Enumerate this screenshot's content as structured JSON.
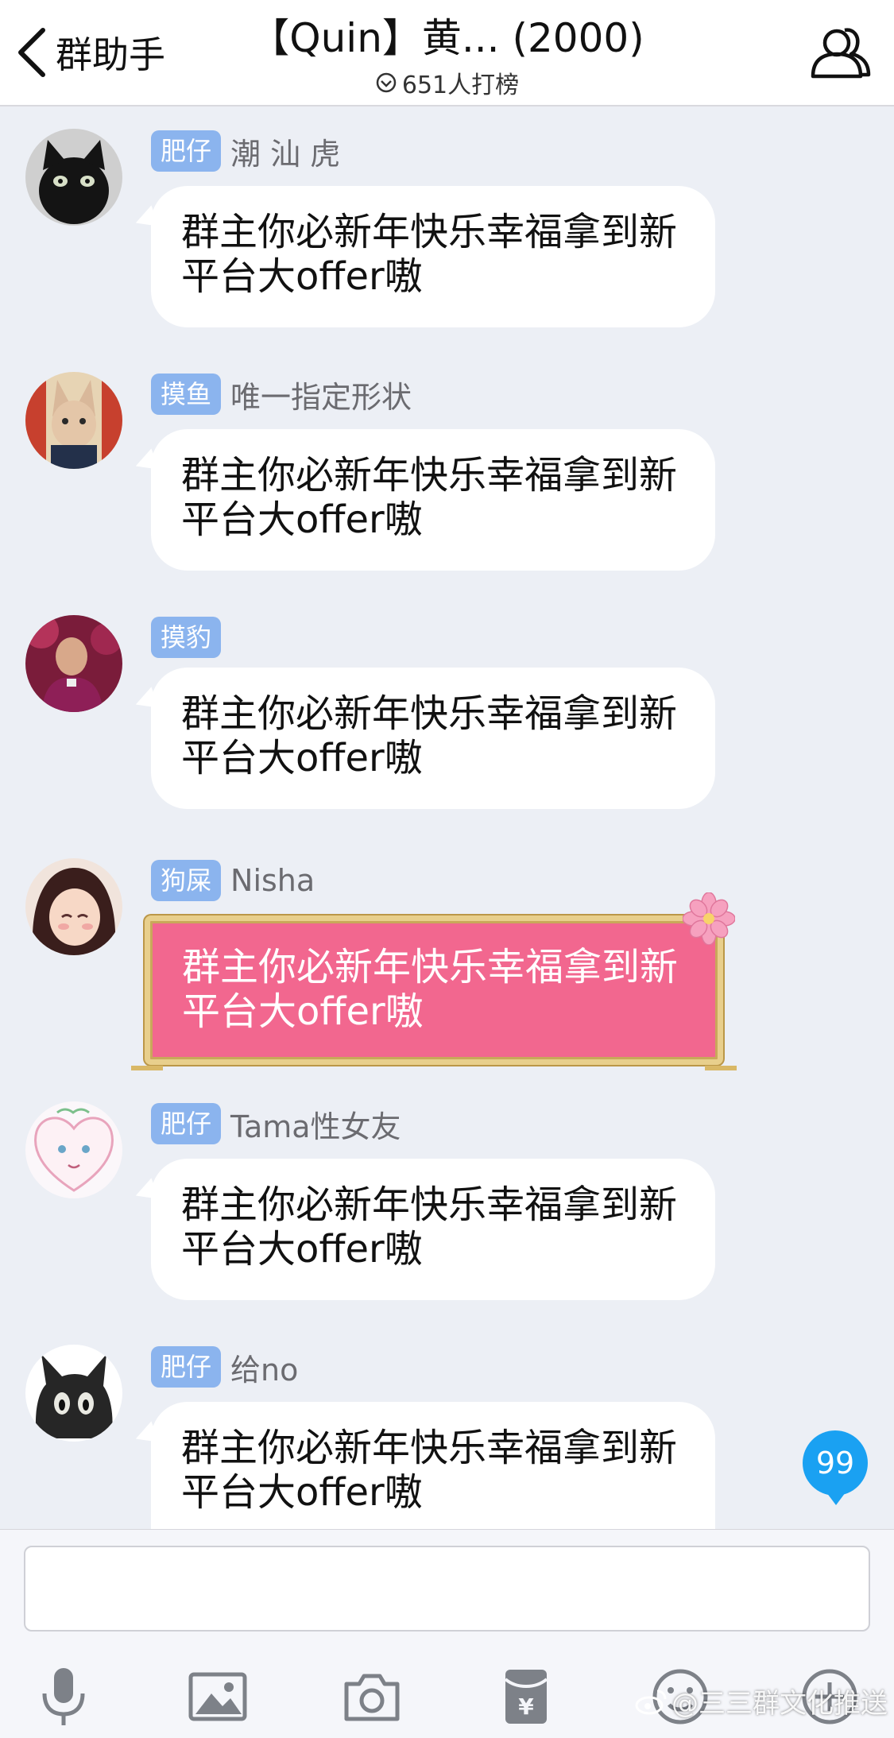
{
  "header": {
    "back_label": "群助手",
    "title": "【Quin】黄... (2000)",
    "subtitle": "651人打榜"
  },
  "messages": [
    {
      "badge": "肥仔",
      "sender": "潮 汕 虎",
      "line1": "群主你必新年快乐幸福拿到新",
      "line2": "平台大offer嗷",
      "avatar": "black-cat-photo-avatar"
    },
    {
      "badge": "摸鱼",
      "sender": "唯一指定形状",
      "line1": "群主你必新年快乐幸福拿到新",
      "line2": "平台大offer嗷",
      "avatar": "sphynx-cat-art-avatar"
    },
    {
      "badge": "摸豹",
      "sender": "",
      "line1": "群主你必新年快乐幸福拿到新",
      "line2": "平台大offer嗷",
      "avatar": "clergyman-photo-avatar"
    },
    {
      "badge": "狗屎",
      "sender": "Nisha",
      "line1": "群主你必新年快乐幸福拿到新",
      "line2": "平台大offer嗷",
      "avatar": "anime-girl-avatar",
      "style": "pink-special"
    },
    {
      "badge": "肥仔",
      "sender": "Tama性女友",
      "line1": "群主你必新年快乐幸福拿到新",
      "line2": "平台大offer嗷",
      "avatar": "sketch-heart-avatar"
    },
    {
      "badge": "肥仔",
      "sender": "给no",
      "line1": "群主你必新年快乐幸福拿到新",
      "line2": "平台大offer嗷",
      "avatar": "cartoon-black-cat-avatar"
    }
  ],
  "unread_count": "99",
  "input": {
    "value": "",
    "placeholder": ""
  },
  "toolbar": [
    "microphone-icon",
    "image-icon",
    "camera-icon",
    "red-packet-icon",
    "emoji-icon",
    "plus-icon"
  ],
  "watermark": "@三三群文化推送",
  "colors": {
    "badge": "#8bb4ee",
    "pink_bubble": "#f2678f",
    "unread": "#1aa1f2",
    "background": "#eceff5"
  }
}
